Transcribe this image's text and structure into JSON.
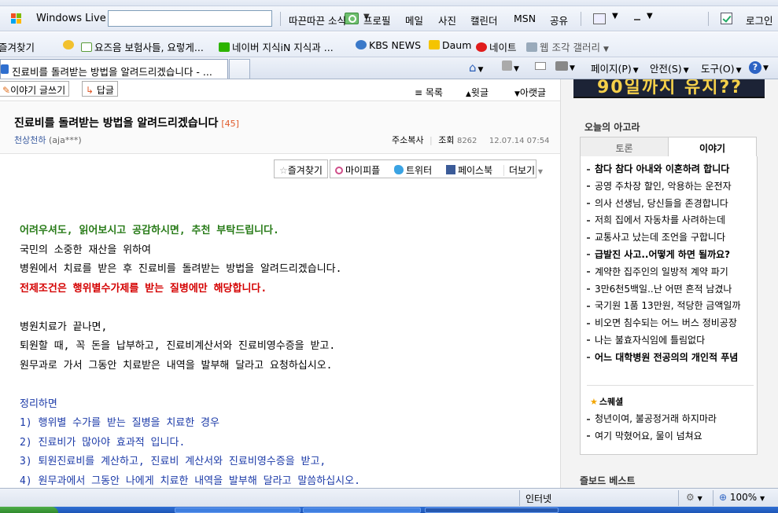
{
  "toolbar1": {
    "brand_label": "Windows Live",
    "search_placeholder": "",
    "links": [
      "따끈따끈 소식",
      "프로필",
      "메일",
      "사진",
      "캘린더",
      "MSN",
      "공유"
    ],
    "login_label": "로그인"
  },
  "favorites": {
    "label": "즐겨찾기",
    "items": [
      "요즈음 보험사들, 요렇게...",
      "네이버 지식iN  지식과 ...",
      "KBS NEWS",
      "Daum",
      "네이트",
      "웹 조각 갤러리"
    ]
  },
  "browser_tab": {
    "title": "진료비를 돌려받는 방법을 알려드리겠습니다 - ..."
  },
  "command_bar": {
    "page": "페이지(P)",
    "safety": "안전(S)",
    "tools": "도구(O)"
  },
  "article": {
    "write_button": "이야기 글쓰기",
    "reply_button": "답글",
    "list_link": "목록",
    "prev_link": "윗글",
    "next_link": "아랫글",
    "title": "진료비를 돌려받는 방법을 알려드리겠습니다",
    "comment_count": "[45]",
    "author_nick": "천상천하",
    "author_id": "(aja***)",
    "copy_address": "주소복사",
    "views_label": "조회",
    "views": "8262",
    "datetime": "12.07.14 07:54",
    "share": {
      "favorite": "즐겨찾기",
      "mypeople": "마이피플",
      "twitter": "트위터",
      "facebook": "페이스북",
      "more": "더보기"
    },
    "body_lines": [
      {
        "text": "어려우셔도, 읽어보시고 공감하시면, 추천 부탁드립니다.",
        "style": "green"
      },
      {
        "text": "국민의 소중한 재산을 위하여",
        "style": "normal"
      },
      {
        "text": "병원에서 치료를 받은 후 진료비를 돌려받는 방법을 알려드리겠습니다.",
        "style": "normal"
      },
      {
        "text": "전제조건은 행위별수가제를 받는 질병에만 해당합니다.",
        "style": "red"
      },
      {
        "text": "",
        "style": "normal"
      },
      {
        "text": "병원치료가 끝나면,",
        "style": "normal"
      },
      {
        "text": "퇴원할 때, 꼭 돈을 납부하고, 진료비계산서와 진료비영수증을 받고.",
        "style": "normal"
      },
      {
        "text": "원무과로 가서 그동안 치료받은 내역을 발부해 달라고 요청하십시오.",
        "style": "normal"
      },
      {
        "text": "",
        "style": "normal"
      },
      {
        "text": "정리하면",
        "style": "blue"
      },
      {
        "text": "1) 행위별 수가를 받는 질병을 치료한 경우",
        "style": "blue"
      },
      {
        "text": "2) 진료비가 많아야 효과적 입니다.",
        "style": "blue"
      },
      {
        "text": "3) 퇴원진료비를 계산하고, 진료비 계산서와 진료비영수증을 받고,",
        "style": "blue"
      },
      {
        "text": "4) 원무과에서 그동안 나에게 치료한 내역을 발부해 달라고 말씀하십시오.",
        "style": "blue"
      }
    ]
  },
  "sidebar": {
    "banner_text": "90일까지 유지??",
    "today_heading": "오늘의 아고라",
    "tab_debate": "토론",
    "tab_story": "이야기",
    "issues": [
      {
        "text": "참다 참다 아내와 이혼하려 합니다",
        "bold": true
      },
      {
        "text": "공영 주차장 할인, 악용하는 운전자",
        "bold": false
      },
      {
        "text": "의사 선생님, 당신들을 존경합니다",
        "bold": false
      },
      {
        "text": "저희 집에서 자동차를 사려하는데",
        "bold": false
      },
      {
        "text": "교통사고 났는데 조언을 구합니다",
        "bold": false
      },
      {
        "text": "급발진 사고..어떻게 하면 될까요?",
        "bold": true
      },
      {
        "text": "계약한 집주인의 일방적 계약 파기",
        "bold": false
      },
      {
        "text": "3만6천5백일..난 어떤 흔적 남겼나",
        "bold": false
      },
      {
        "text": "국기원 1품 13만원, 적당한 금액일까",
        "bold": false
      },
      {
        "text": "비오면 침수되는 어느 버스 정비공장",
        "bold": false
      },
      {
        "text": "나는 불효자식임에 틀림없다",
        "bold": false
      },
      {
        "text": "어느 대학병원 전공의의 개인적 푸념",
        "bold": true
      }
    ],
    "star_heading": "스퀘셜",
    "star_items": [
      "청년이여, 불공정거래 하지마라",
      "여기 막혔어요, 물이 넘쳐요"
    ],
    "best_heading": "즐보드 베스트"
  },
  "statusbar": {
    "zone": "인터넷",
    "zoom": "100%"
  }
}
